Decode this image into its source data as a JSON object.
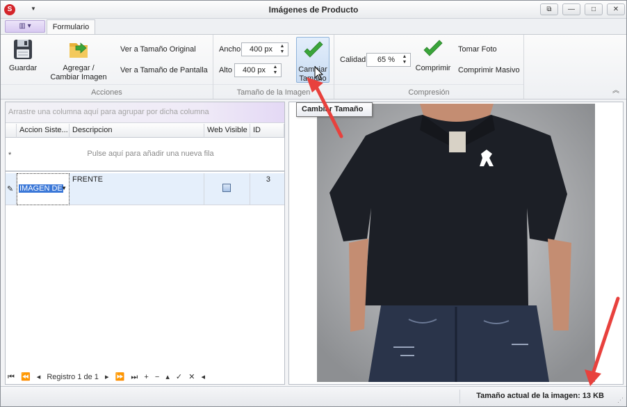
{
  "window": {
    "title": "Imágenes de Producto",
    "app_icon_glyph": "S",
    "controls": {
      "restore": "⧉",
      "minimize": "—",
      "maximize": "□",
      "close": "✕"
    }
  },
  "ribbon": {
    "app_menu_glyph": "▥ ▾",
    "tab_formulario": "Formulario",
    "groups": {
      "acciones": {
        "label": "Acciones",
        "guardar": "Guardar",
        "agregar_line1": "Agregar /",
        "agregar_line2": "Cambiar Imagen",
        "ver_original": "Ver a Tamaño Original",
        "ver_pantalla": "Ver a Tamaño de Pantalla"
      },
      "tamano": {
        "label": "Tamaño de la Imagen",
        "ancho_label": "Ancho",
        "ancho_value": "400 px",
        "alto_label": "Alto",
        "alto_value": "400 px",
        "cambiar_line1": "Cambiar",
        "cambiar_line2": "Tamaño"
      },
      "compresion": {
        "label": "Compresión",
        "calidad_label": "Calidad",
        "calidad_value": "65 %",
        "comprimir": "Comprimir",
        "tomar_foto": "Tomar Foto",
        "comprimir_masivo": "Comprimir Masivo"
      }
    },
    "collapse_glyph": "︽"
  },
  "tooltip": "Cambiar Tamaño",
  "grid": {
    "group_hint": "Arrastre una columna aquí para agrupar por dicha columna",
    "columns": [
      "Accion Siste...",
      "Descripcion",
      "Web Visible",
      "ID"
    ],
    "new_row_marker": "*",
    "new_row_text": "Pulse aquí para añadir una nueva fila",
    "row": {
      "edit_marker": "✎",
      "accion": "IMAGEN DE",
      "descripcion": "FRENTE",
      "id": "3"
    },
    "navigator": {
      "first": "⏮",
      "prev_page": "⏪",
      "prev": "◂",
      "record_text": "Registro 1 de 1",
      "next": "▸",
      "next_page": "⏩",
      "last": "⏭",
      "add": "+",
      "remove": "−",
      "up": "▴",
      "save": "✓",
      "cancel": "✕",
      "scroll": "◂"
    }
  },
  "status": {
    "text": "Tamaño actual de la imagen: 13 KB",
    "grip": "⋰"
  },
  "colors": {
    "accent_red": "#e8413d",
    "check_green": "#3aa53a",
    "selection_blue": "#3b78d8"
  }
}
